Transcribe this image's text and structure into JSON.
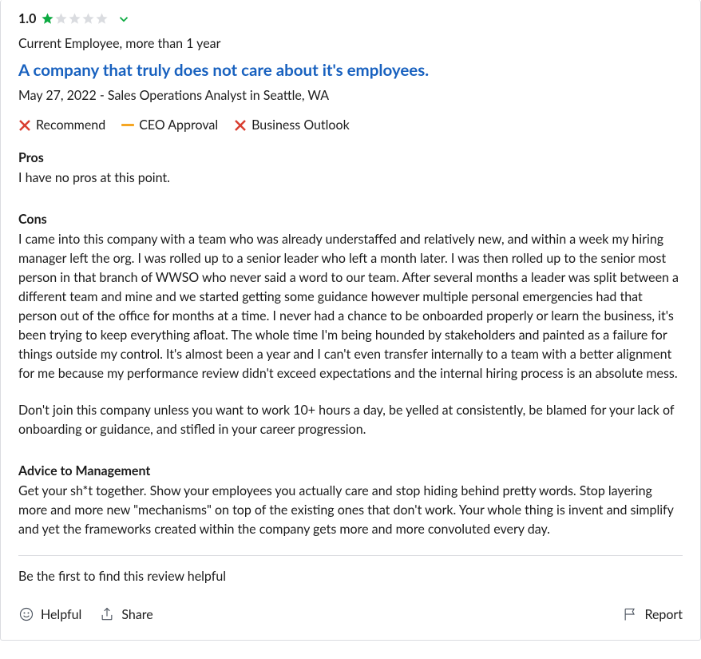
{
  "rating": {
    "value": "1.0",
    "filled_stars": 1,
    "total_stars": 5
  },
  "employment_status": "Current Employee, more than 1 year",
  "title": "A company that truly does not care about it's employees.",
  "meta": "May 27, 2022 - Sales Operations Analyst in Seattle, WA",
  "indicators": {
    "recommend": {
      "label": "Recommend",
      "state": "no"
    },
    "ceo": {
      "label": "CEO Approval",
      "state": "neutral"
    },
    "outlook": {
      "label": "Business Outlook",
      "state": "no"
    }
  },
  "sections": {
    "pros_head": "Pros",
    "pros_body": "I have no pros at this point.",
    "cons_head": "Cons",
    "cons_p1": "I came into this company with a team who was already understaffed and relatively new, and within a week my hiring manager left the org. I was rolled up to a senior leader who left a month later. I was then rolled up to the senior most person in that branch of WWSO who never said a word to our team. After several months a leader was split between a different team and mine and we started getting some guidance however multiple personal emergencies had that person out of the office for months at a time. I never had a chance to be onboarded properly or learn the business, it's been trying to keep everything afloat. The whole time I'm being hounded by stakeholders and painted as a failure for things outside my control. It's almost been a year and I can't even transfer internally to a team with a better alignment for me because my performance review didn't exceed expectations and the internal hiring process is an absolute mess.",
    "cons_p2": "Don't join this company unless you want to work 10+ hours a day, be yelled at consistently, be blamed for your lack of onboarding or guidance, and stifled in your career progression.",
    "advice_head": "Advice to Management",
    "advice_body": "Get your sh*t together. Show your employees you actually care and stop hiding behind pretty words. Stop layering more and more new \"mechanisms\" on top of the existing ones that don't work. Your whole thing is invent and simplify and yet the frameworks created within the company gets more and more convoluted every day."
  },
  "helpful_line": "Be the first to find this review helpful",
  "actions": {
    "helpful": "Helpful",
    "share": "Share",
    "report": "Report"
  }
}
